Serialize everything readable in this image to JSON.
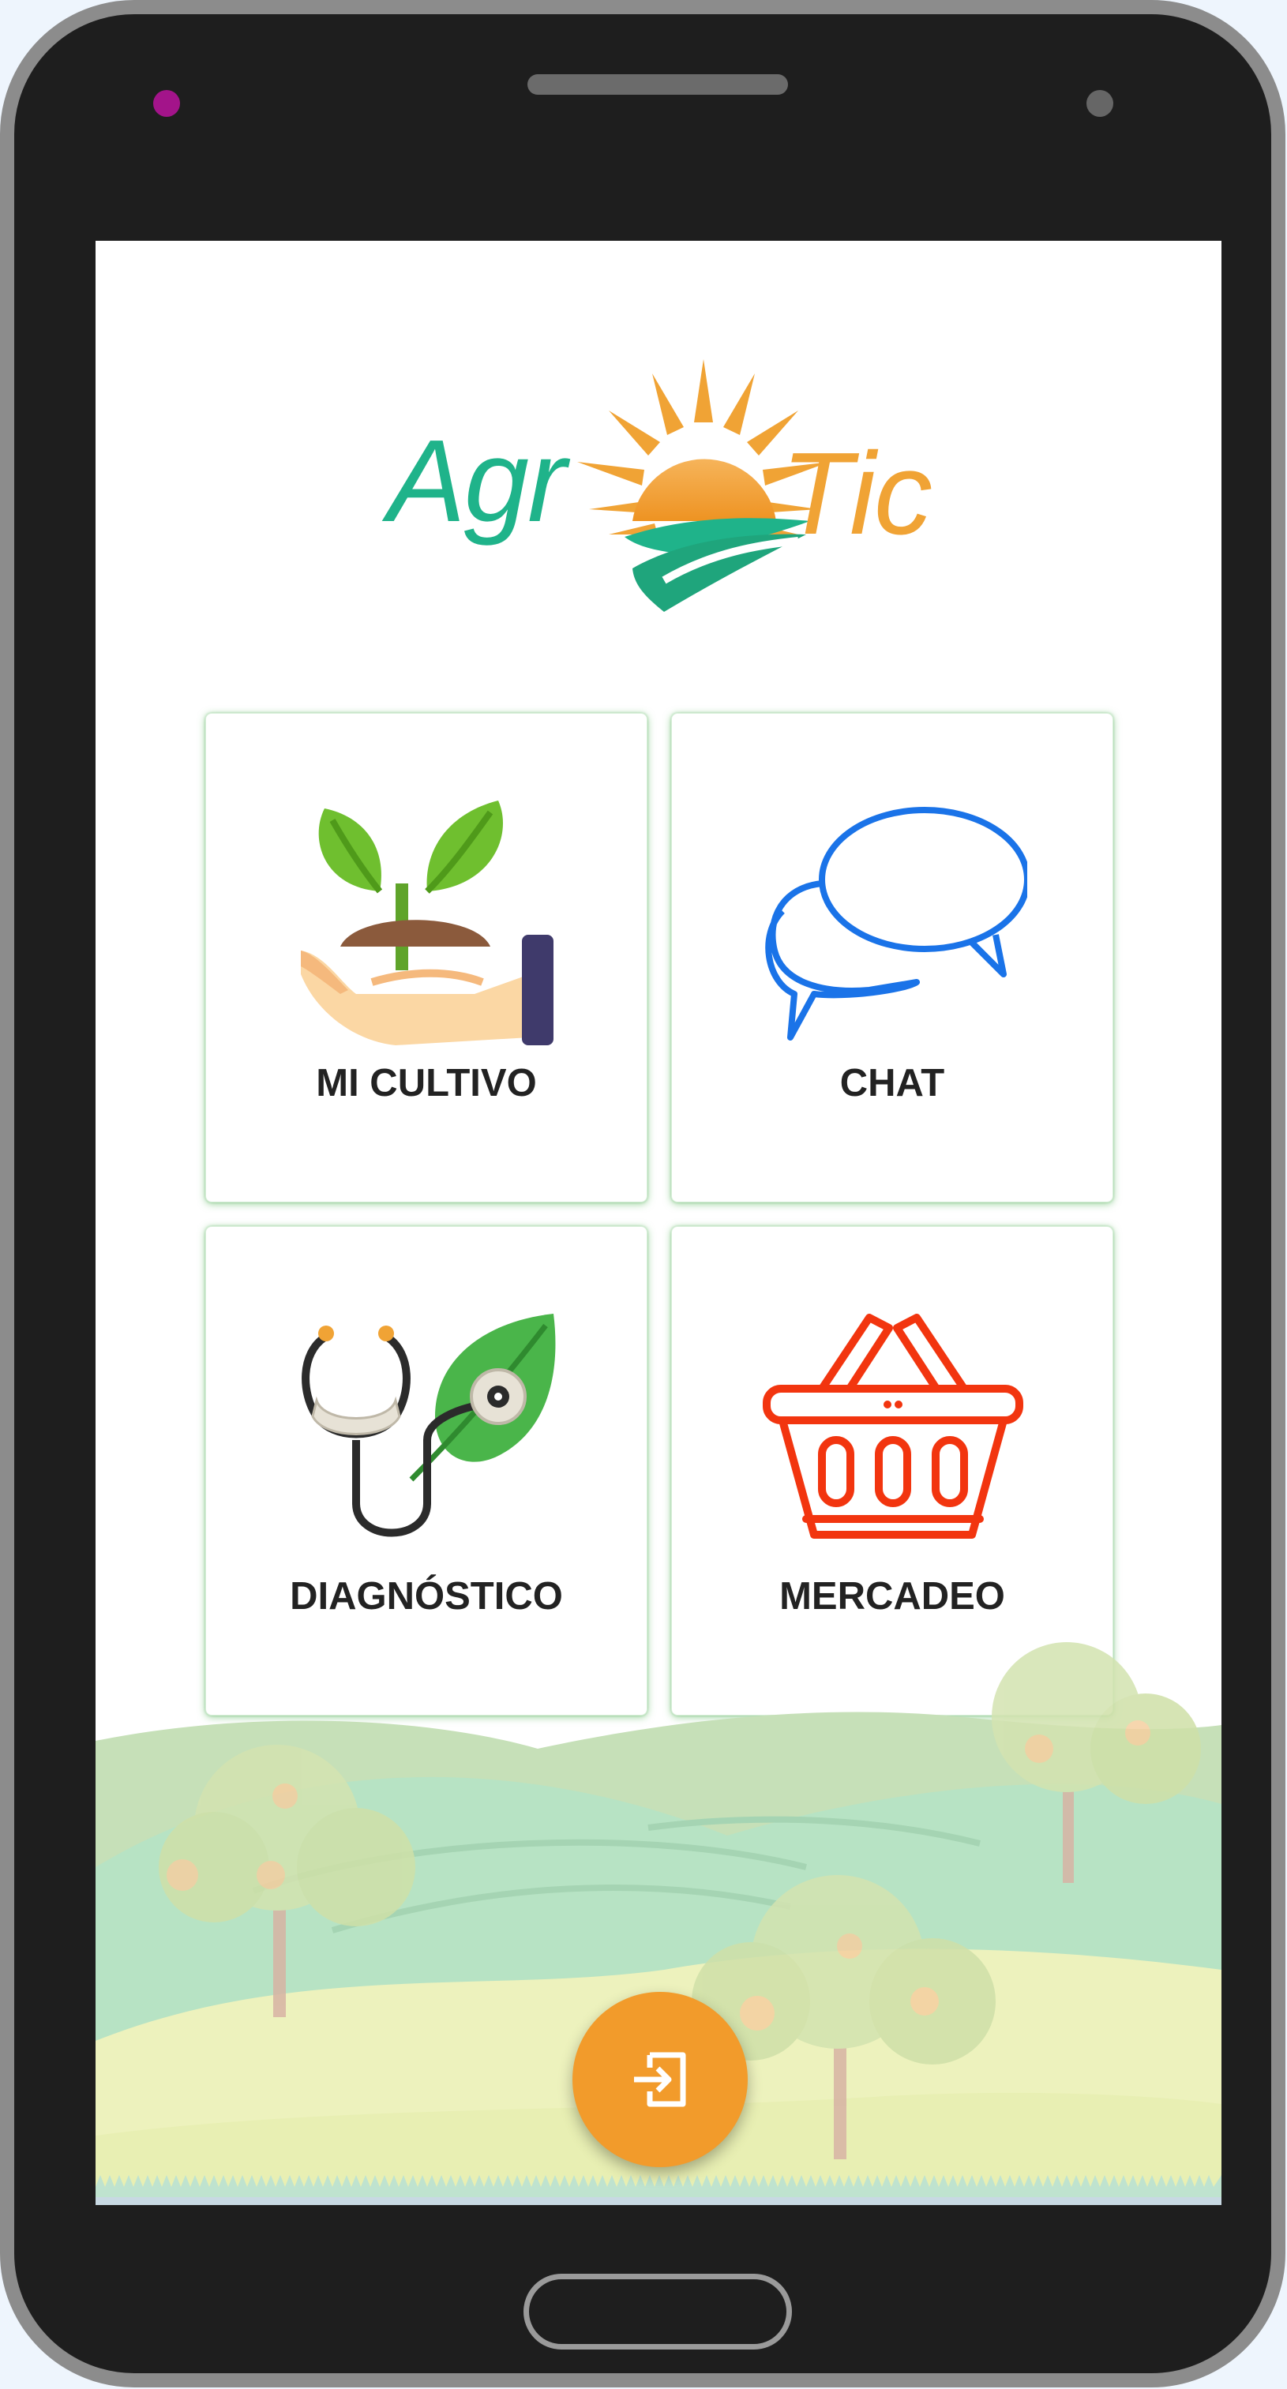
{
  "logo": {
    "text_left": "Agr",
    "text_right": "Tic",
    "color_left": "#1fb38a",
    "color_right": "#f0a335",
    "icon": "sun-over-field-icon"
  },
  "menu": {
    "tiles": [
      {
        "label": "MI CULTIVO",
        "icon": "seedling-hand-icon"
      },
      {
        "label": "CHAT",
        "icon": "chat-bubbles-icon"
      },
      {
        "label": "DIAGNÓSTICO",
        "icon": "stethoscope-leaf-icon"
      },
      {
        "label": "MERCADEO",
        "icon": "shopping-basket-icon"
      }
    ]
  },
  "fab": {
    "icon": "logout-icon",
    "color": "#f29b2b"
  },
  "colors": {
    "tile_border": "#4caf50",
    "chat_icon": "#1a73e8",
    "market_icon": "#f2350f"
  }
}
